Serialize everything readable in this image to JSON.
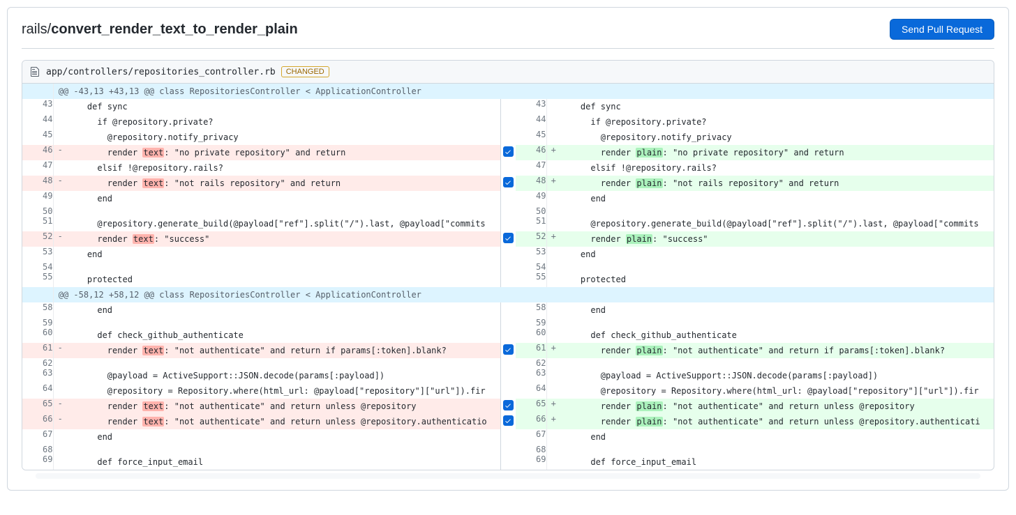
{
  "header": {
    "repo": "rails",
    "branch": "convert_render_text_to_render_plain",
    "button": "Send Pull Request"
  },
  "file": {
    "path": "app/controllers/repositories_controller.rb",
    "status": "CHANGED"
  },
  "hunks": [
    {
      "header": "@@ -43,13 +43,13 @@ class RepositoriesController < ApplicationController",
      "rows": [
        {
          "ln_l": "43",
          "ln_r": "43",
          "type": "ctx",
          "left": "    def sync",
          "right": "    def sync"
        },
        {
          "ln_l": "44",
          "ln_r": "44",
          "type": "ctx",
          "left": "      if @repository.private?",
          "right": "      if @repository.private?"
        },
        {
          "ln_l": "45",
          "ln_r": "45",
          "type": "ctx",
          "left": "        @repository.notify_privacy",
          "right": "        @repository.notify_privacy"
        },
        {
          "ln_l": "46",
          "ln_r": "46",
          "type": "chg",
          "check": true,
          "left_pre": "        render ",
          "left_hl": "text",
          "left_post": ": \"no private repository\" and return",
          "right_pre": "        render ",
          "right_hl": "plain",
          "right_post": ": \"no private repository\" and return"
        },
        {
          "ln_l": "47",
          "ln_r": "47",
          "type": "ctx",
          "left": "      elsif !@repository.rails?",
          "right": "      elsif !@repository.rails?"
        },
        {
          "ln_l": "48",
          "ln_r": "48",
          "type": "chg",
          "check": true,
          "left_pre": "        render ",
          "left_hl": "text",
          "left_post": ": \"not rails repository\" and return",
          "right_pre": "        render ",
          "right_hl": "plain",
          "right_post": ": \"not rails repository\" and return"
        },
        {
          "ln_l": "49",
          "ln_r": "49",
          "type": "ctx",
          "left": "      end",
          "right": "      end"
        },
        {
          "ln_l": "50",
          "ln_r": "50",
          "type": "ctx",
          "left": "",
          "right": ""
        },
        {
          "ln_l": "51",
          "ln_r": "51",
          "type": "ctx",
          "left": "      @repository.generate_build(@payload[\"ref\"].split(\"/\").last, @payload[\"commits",
          "right": "      @repository.generate_build(@payload[\"ref\"].split(\"/\").last, @payload[\"commits"
        },
        {
          "ln_l": "52",
          "ln_r": "52",
          "type": "chg",
          "check": true,
          "left_pre": "      render ",
          "left_hl": "text",
          "left_post": ": \"success\"",
          "right_pre": "      render ",
          "right_hl": "plain",
          "right_post": ": \"success\""
        },
        {
          "ln_l": "53",
          "ln_r": "53",
          "type": "ctx",
          "left": "    end",
          "right": "    end"
        },
        {
          "ln_l": "54",
          "ln_r": "54",
          "type": "ctx",
          "left": "",
          "right": ""
        },
        {
          "ln_l": "55",
          "ln_r": "55",
          "type": "ctx",
          "left": "    protected",
          "right": "    protected"
        }
      ]
    },
    {
      "header": "@@ -58,12 +58,12 @@ class RepositoriesController < ApplicationController",
      "rows": [
        {
          "ln_l": "58",
          "ln_r": "58",
          "type": "ctx",
          "left": "      end",
          "right": "      end"
        },
        {
          "ln_l": "59",
          "ln_r": "59",
          "type": "ctx",
          "left": "",
          "right": ""
        },
        {
          "ln_l": "60",
          "ln_r": "60",
          "type": "ctx",
          "left": "      def check_github_authenticate",
          "right": "      def check_github_authenticate"
        },
        {
          "ln_l": "61",
          "ln_r": "61",
          "type": "chg",
          "check": true,
          "left_pre": "        render ",
          "left_hl": "text",
          "left_post": ": \"not authenticate\" and return if params[:token].blank?",
          "right_pre": "        render ",
          "right_hl": "plain",
          "right_post": ": \"not authenticate\" and return if params[:token].blank?"
        },
        {
          "ln_l": "62",
          "ln_r": "62",
          "type": "ctx",
          "left": "",
          "right": ""
        },
        {
          "ln_l": "63",
          "ln_r": "63",
          "type": "ctx",
          "left": "        @payload = ActiveSupport::JSON.decode(params[:payload])",
          "right": "        @payload = ActiveSupport::JSON.decode(params[:payload])"
        },
        {
          "ln_l": "64",
          "ln_r": "64",
          "type": "ctx",
          "left": "        @repository = Repository.where(html_url: @payload[\"repository\"][\"url\"]).fir",
          "right": "        @repository = Repository.where(html_url: @payload[\"repository\"][\"url\"]).fir"
        },
        {
          "ln_l": "65",
          "ln_r": "65",
          "type": "chg",
          "check": true,
          "left_pre": "        render ",
          "left_hl": "text",
          "left_post": ": \"not authenticate\" and return unless @repository",
          "right_pre": "        render ",
          "right_hl": "plain",
          "right_post": ": \"not authenticate\" and return unless @repository"
        },
        {
          "ln_l": "66",
          "ln_r": "66",
          "type": "chg",
          "check": true,
          "left_pre": "        render ",
          "left_hl": "text",
          "left_post": ": \"not authenticate\" and return unless @repository.authenticatio",
          "right_pre": "        render ",
          "right_hl": "plain",
          "right_post": ": \"not authenticate\" and return unless @repository.authenticati"
        },
        {
          "ln_l": "67",
          "ln_r": "67",
          "type": "ctx",
          "left": "      end",
          "right": "      end"
        },
        {
          "ln_l": "68",
          "ln_r": "68",
          "type": "ctx",
          "left": "",
          "right": ""
        },
        {
          "ln_l": "69",
          "ln_r": "69",
          "type": "ctx",
          "left": "      def force_input_email",
          "right": "      def force_input_email"
        }
      ]
    }
  ]
}
